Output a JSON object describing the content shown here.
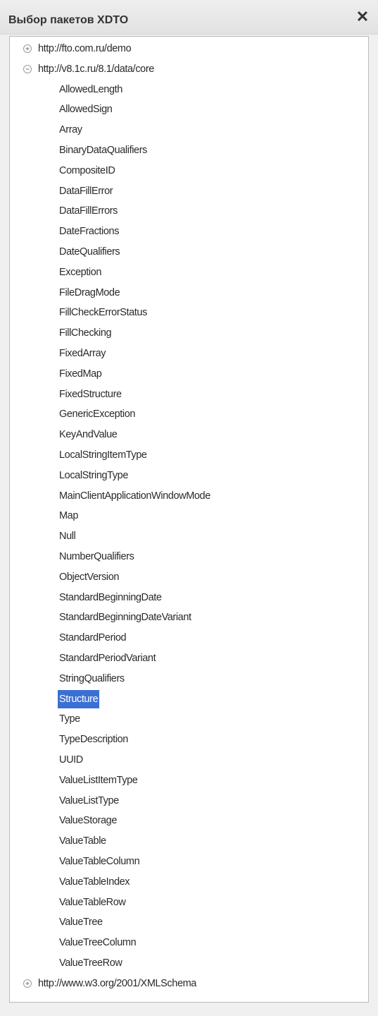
{
  "window": {
    "title": "Выбор пакетов XDTO",
    "close_glyph": "✕",
    "close_icon": "close-icon"
  },
  "tree": {
    "packages": [
      {
        "label": "http://fto.com.ru/demo",
        "expanded": false,
        "icon": "expand-plus-icon"
      },
      {
        "label": "http://v8.1c.ru/8.1/data/core",
        "expanded": true,
        "icon": "collapse-minus-icon"
      }
    ],
    "children": [
      "AllowedLength",
      "AllowedSign",
      "Array",
      "BinaryDataQualifiers",
      "CompositeID",
      "DataFillError",
      "DataFillErrors",
      "DateFractions",
      "DateQualifiers",
      "Exception",
      "FileDragMode",
      "FillCheckErrorStatus",
      "FillChecking",
      "FixedArray",
      "FixedMap",
      "FixedStructure",
      "GenericException",
      "KeyAndValue",
      "LocalStringItemType",
      "LocalStringType",
      "MainClientApplicationWindowMode",
      "Map",
      "Null",
      "NumberQualifiers",
      "ObjectVersion",
      "StandardBeginningDate",
      "StandardBeginningDateVariant",
      "StandardPeriod",
      "StandardPeriodVariant",
      "StringQualifiers",
      "Structure",
      "Type",
      "TypeDescription",
      "UUID",
      "ValueListItemType",
      "ValueListType",
      "ValueStorage",
      "ValueTable",
      "ValueTableColumn",
      "ValueTableIndex",
      "ValueTableRow",
      "ValueTree",
      "ValueTreeColumn",
      "ValueTreeRow"
    ],
    "selected": "Structure",
    "last_package": {
      "label": "http://www.w3.org/2001/XMLSchema",
      "expanded": false,
      "icon": "expand-plus-icon"
    }
  },
  "colors": {
    "selection": "#3b6fd3",
    "text": "#2a2a2a"
  }
}
